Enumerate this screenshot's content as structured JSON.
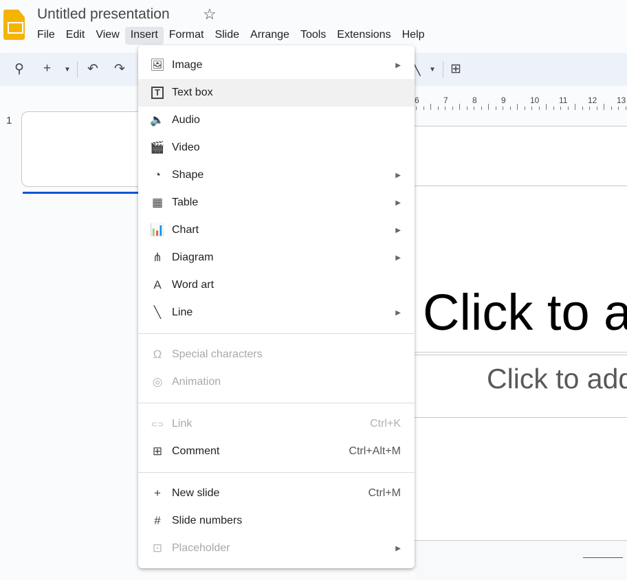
{
  "app": {
    "title": "Untitled presentation",
    "brand_color": "#f4b400"
  },
  "menubar": [
    "File",
    "Edit",
    "View",
    "Insert",
    "Format",
    "Slide",
    "Arrange",
    "Tools",
    "Extensions",
    "Help"
  ],
  "active_menu": "Insert",
  "ruler": [
    "6",
    "7",
    "8",
    "9",
    "10",
    "11",
    "12",
    "13"
  ],
  "thumbnail": {
    "number": "1"
  },
  "slide": {
    "title_placeholder": "Click to a",
    "subtitle_placeholder": "Click to add"
  },
  "insert_menu": {
    "groups": [
      [
        {
          "label": "Image",
          "icon": "image-icon",
          "glyph": "🖼",
          "submenu": true
        },
        {
          "label": "Text box",
          "icon": "text-box-icon",
          "glyph": "T",
          "hover": true
        },
        {
          "label": "Audio",
          "icon": "audio-icon",
          "glyph": "🔈"
        },
        {
          "label": "Video",
          "icon": "video-icon",
          "glyph": "🎬"
        },
        {
          "label": "Shape",
          "icon": "shape-icon",
          "glyph": "◔",
          "submenu": true
        },
        {
          "label": "Table",
          "icon": "table-icon",
          "glyph": "▦",
          "submenu": true
        },
        {
          "label": "Chart",
          "icon": "chart-icon",
          "glyph": "📊",
          "submenu": true
        },
        {
          "label": "Diagram",
          "icon": "diagram-icon",
          "glyph": "⋔",
          "submenu": true
        },
        {
          "label": "Word art",
          "icon": "word-art-icon",
          "glyph": "A"
        },
        {
          "label": "Line",
          "icon": "line-icon",
          "glyph": "╲",
          "submenu": true
        }
      ],
      [
        {
          "label": "Special characters",
          "icon": "omega-icon",
          "glyph": "Ω",
          "disabled": true
        },
        {
          "label": "Animation",
          "icon": "animation-icon",
          "glyph": "◎",
          "disabled": true
        }
      ],
      [
        {
          "label": "Link",
          "icon": "link-icon",
          "glyph": "⊂⊃",
          "shortcut": "Ctrl+K",
          "disabled": true
        },
        {
          "label": "Comment",
          "icon": "comment-add-icon",
          "glyph": "⊞",
          "shortcut": "Ctrl+Alt+M"
        }
      ],
      [
        {
          "label": "New slide",
          "icon": "plus-icon",
          "glyph": "+",
          "shortcut": "Ctrl+M"
        },
        {
          "label": "Slide numbers",
          "icon": "hash-icon",
          "glyph": "#"
        },
        {
          "label": "Placeholder",
          "icon": "placeholder-icon",
          "glyph": "⊡",
          "submenu": true,
          "disabled": true
        }
      ]
    ]
  }
}
